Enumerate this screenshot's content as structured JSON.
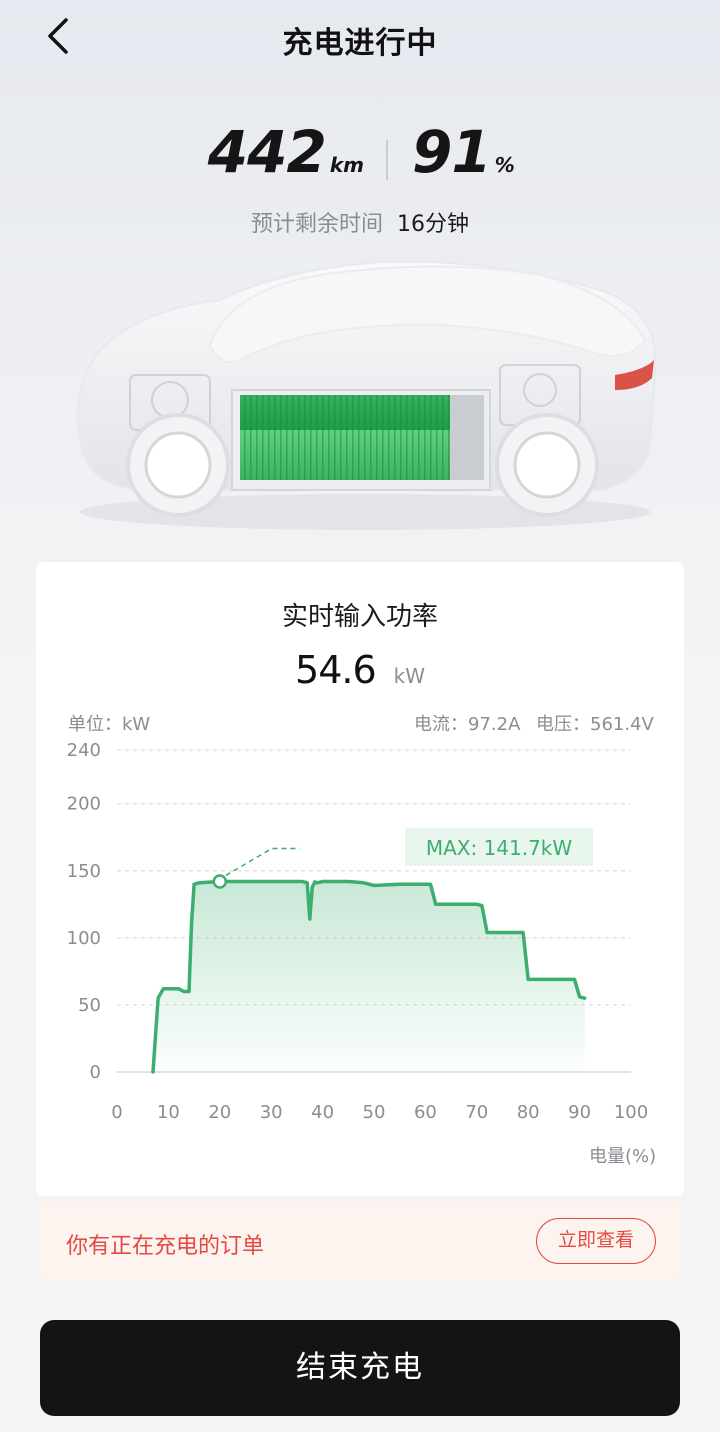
{
  "header": {
    "title": "充电进行中",
    "back_icon": "chevron-left-icon"
  },
  "stats": {
    "range_value": "442",
    "range_unit": "km",
    "battery_value": "91",
    "battery_unit": "%",
    "remaining_label": "预计剩余时间",
    "remaining_value": "16分钟"
  },
  "colors": {
    "accent_green": "#3cae6f",
    "battery_green": "#2eb35a",
    "warning_red": "#e24a42",
    "button_dark": "#141414"
  },
  "power": {
    "title": "实时输入功率",
    "value": "54.6",
    "unit": "kW",
    "unit_label": "单位：kW",
    "current_label": "电流：97.2A",
    "voltage_label": "电压：561.4V"
  },
  "chart_data": {
    "type": "area",
    "title": "",
    "xlabel": "电量(%)",
    "ylabel": "单位：kW",
    "xlim": [
      0,
      100
    ],
    "ylim": [
      0,
      240
    ],
    "x_ticks": [
      "0",
      "10",
      "20",
      "30",
      "40",
      "50",
      "60",
      "70",
      "80",
      "90",
      "100"
    ],
    "y_ticks": [
      "240",
      "200",
      "150",
      "100",
      "50",
      "0"
    ],
    "grid": true,
    "annotation": "MAX: 141.7kW",
    "series": [
      {
        "x": [
          7,
          8,
          9,
          10,
          11,
          12,
          13,
          14,
          14.5,
          15,
          16,
          20,
          25,
          30,
          35,
          36,
          37,
          37.5,
          38,
          38.5,
          39,
          40,
          45,
          48,
          50,
          55,
          60,
          61,
          62,
          65,
          70,
          71,
          72,
          73,
          75,
          79,
          80,
          81,
          85,
          89,
          90,
          91
        ],
        "y": [
          0,
          55,
          62,
          62,
          62,
          62,
          60,
          60,
          110,
          140,
          141,
          142,
          142,
          142,
          142,
          142,
          141,
          114,
          138,
          141.7,
          141,
          142,
          142,
          141,
          139,
          140,
          140,
          140,
          125,
          125,
          125,
          124,
          104,
          104,
          104,
          104,
          69,
          69,
          69,
          69,
          56,
          55
        ]
      }
    ]
  },
  "notice": {
    "text": "你有正在充电的订单",
    "button": "立即查看"
  },
  "end_button": "结束充电"
}
